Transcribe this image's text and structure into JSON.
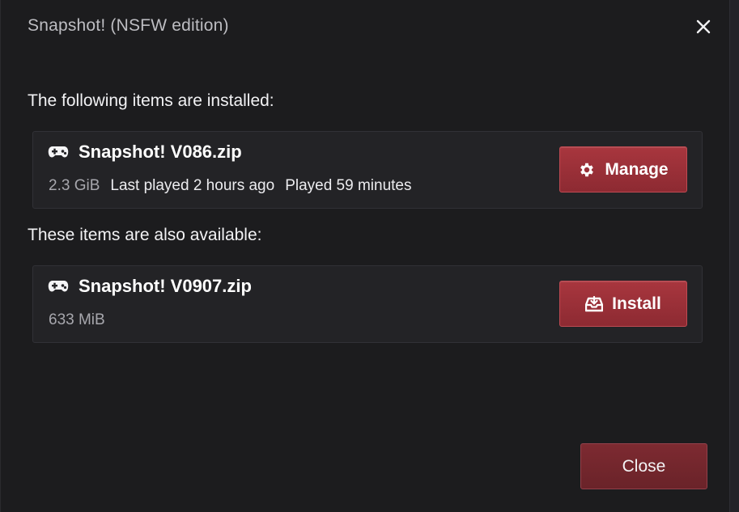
{
  "dialog": {
    "title": "Snapshot! (NSFW edition)",
    "close_icon": "close-icon",
    "installed_heading": "The following items are installed:",
    "available_heading": "These items are also available:",
    "close_button_label": "Close"
  },
  "installed": [
    {
      "icon": "gamepad-icon",
      "name": "Snapshot! V086.zip",
      "size": "2.3 GiB",
      "last_played": "Last played 2 hours ago",
      "played": "Played 59 minutes",
      "action_icon": "gear-icon",
      "action_label": "Manage"
    }
  ],
  "available": [
    {
      "icon": "gamepad-icon",
      "name": "Snapshot! V0907.zip",
      "size": "633 MiB",
      "action_icon": "download-tray-icon",
      "action_label": "Install"
    }
  ],
  "colors": {
    "accent": "#a8363e",
    "dialog_bg": "#1c1c1e",
    "card_bg": "#232326"
  }
}
